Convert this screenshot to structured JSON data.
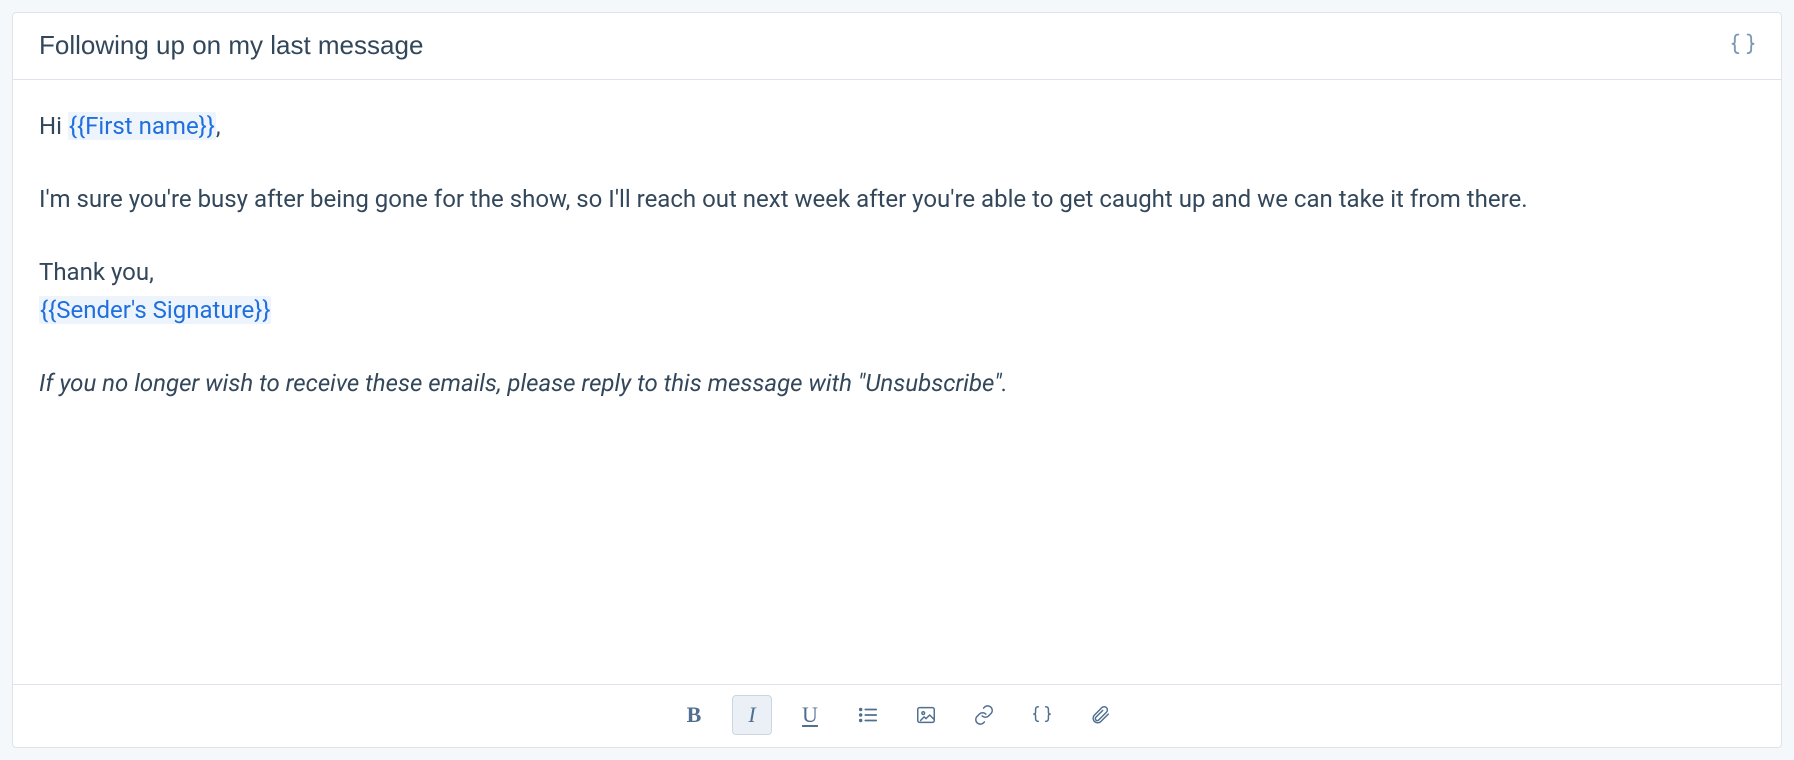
{
  "subject": {
    "value": "Following up on my last message"
  },
  "body": {
    "greeting_prefix": "Hi ",
    "greeting_token": "{{First name}}",
    "greeting_suffix": ",",
    "paragraph1": "I'm sure you're busy after being gone for the show, so I'll reach out next week after you're able to get caught up and we can take it from there.",
    "closing": "Thank you,",
    "signature_token": "{{Sender's Signature}}",
    "unsubscribe": "If you no longer wish to receive these emails, please reply to this message with \"Unsubscribe\"."
  },
  "toolbar": {
    "bold": "B",
    "italic": "I",
    "underline": "U",
    "token": "{ }"
  }
}
